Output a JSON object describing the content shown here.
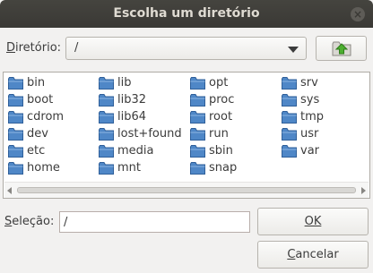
{
  "window": {
    "title": "Escolha um diretório",
    "close_label": "×"
  },
  "directory": {
    "label": "Diretório:",
    "current_value": "/"
  },
  "folders": [
    [
      "bin",
      "boot",
      "cdrom",
      "dev",
      "etc",
      "home"
    ],
    [
      "lib",
      "lib32",
      "lib64",
      "lost+found",
      "media",
      "mnt"
    ],
    [
      "opt",
      "proc",
      "root",
      "run",
      "sbin",
      "snap"
    ],
    [
      "srv",
      "sys",
      "tmp",
      "usr",
      "var"
    ]
  ],
  "selection": {
    "label": "Seleção:",
    "value": "/"
  },
  "buttons": {
    "ok": "OK",
    "cancel": "Cancelar"
  },
  "colors": {
    "folder_blue": "#4f87c7",
    "titlebar": "#3a3935",
    "up_arrow_green": "#4caf30"
  }
}
